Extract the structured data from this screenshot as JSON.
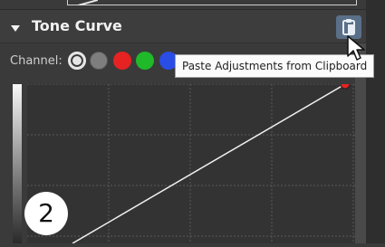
{
  "panel": {
    "title": "Tone Curve",
    "channel_label": "Channel:",
    "channels": [
      {
        "name": "luminosity",
        "color": "#e6e6e6",
        "selected": true
      },
      {
        "name": "gray",
        "color": "#7e7e7e"
      },
      {
        "name": "red",
        "color": "#e62222"
      },
      {
        "name": "green",
        "color": "#1fb92a"
      },
      {
        "name": "blue",
        "color": "#2a4de6"
      }
    ],
    "paste_icon": "clipboard-paste-icon"
  },
  "tooltip": {
    "text": "Paste Adjustments from Clipboard"
  },
  "badge": {
    "text": "2"
  },
  "colors": {
    "background": "#3a3a3a",
    "accent": "#5a6f88",
    "curve_point": "#e62222"
  }
}
